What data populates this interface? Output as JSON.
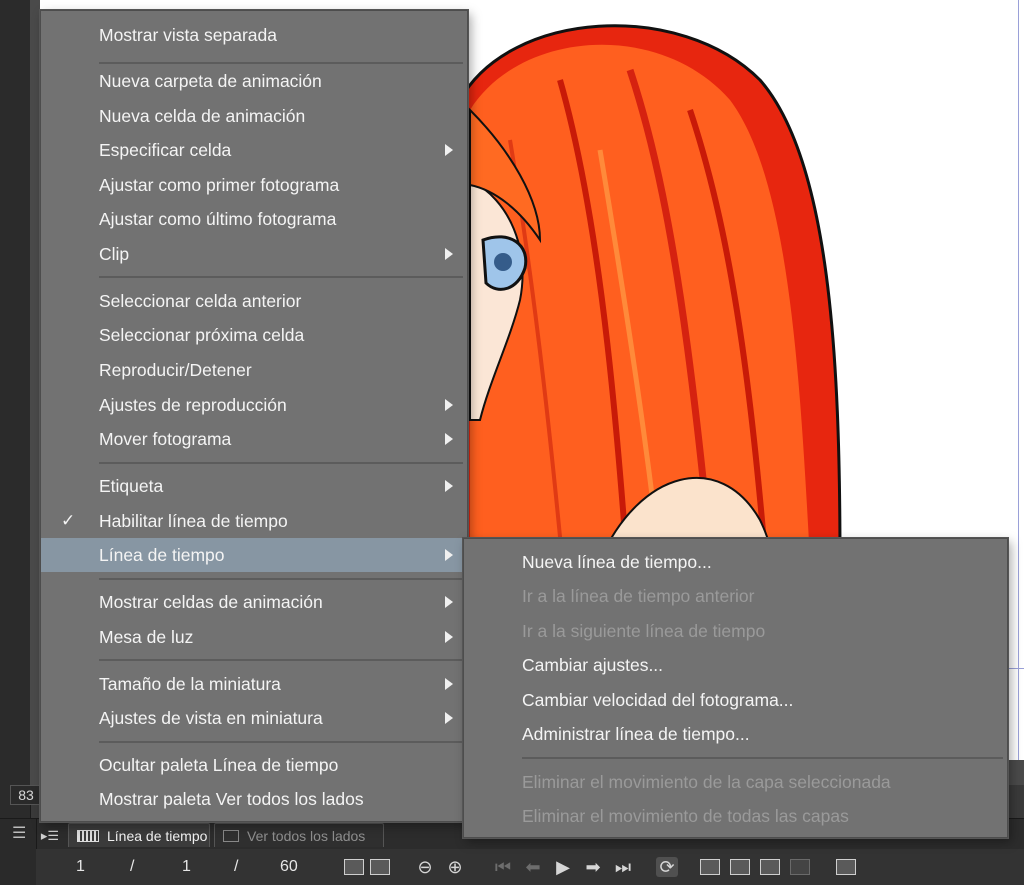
{
  "canvas": {
    "zoom_readout": "83"
  },
  "main_menu": {
    "items": [
      {
        "label": "Mostrar vista separada",
        "submenu": false
      },
      {
        "label": "Nueva carpeta de animación",
        "submenu": false
      },
      {
        "label": "Nueva celda de animación",
        "submenu": false
      },
      {
        "label": "Especificar celda",
        "submenu": true
      },
      {
        "label": "Ajustar como primer fotograma",
        "submenu": false
      },
      {
        "label": "Ajustar como último fotograma",
        "submenu": false
      },
      {
        "label": "Clip",
        "submenu": true
      },
      {
        "label": "Seleccionar celda anterior",
        "submenu": false
      },
      {
        "label": "Seleccionar próxima celda",
        "submenu": false
      },
      {
        "label": "Reproducir/Detener",
        "submenu": false
      },
      {
        "label": "Ajustes de reproducción",
        "submenu": true
      },
      {
        "label": "Mover fotograma",
        "submenu": true
      },
      {
        "label": "Etiqueta",
        "submenu": true
      },
      {
        "label": "Habilitar línea de tiempo",
        "submenu": false,
        "checked": true,
        "check_glyph": "✓"
      },
      {
        "label": "Línea de tiempo",
        "submenu": true,
        "active": true
      },
      {
        "label": "Mostrar celdas de animación",
        "submenu": true
      },
      {
        "label": "Mesa de luz",
        "submenu": true
      },
      {
        "label": "Tamaño de la miniatura",
        "submenu": true
      },
      {
        "label": "Ajustes de vista en miniatura",
        "submenu": true
      },
      {
        "label": "Ocultar paleta Línea de tiempo",
        "submenu": false
      },
      {
        "label": "Mostrar paleta Ver todos los lados",
        "submenu": false
      }
    ]
  },
  "sub_menu": {
    "items": [
      {
        "label": "Nueva línea de tiempo...",
        "enabled": true
      },
      {
        "label": "Ir a la línea de tiempo anterior",
        "enabled": false
      },
      {
        "label": "Ir a la siguiente línea de tiempo",
        "enabled": false
      },
      {
        "label": "Cambiar ajustes...",
        "enabled": true
      },
      {
        "label": "Cambiar velocidad del fotograma...",
        "enabled": true
      },
      {
        "label": "Administrar línea de tiempo...",
        "enabled": true
      },
      {
        "label": "Eliminar el movimiento de la capa seleccionada",
        "enabled": false
      },
      {
        "label": "Eliminar el movimiento de todas las capas",
        "enabled": false
      }
    ]
  },
  "timeline_panel": {
    "tabs": [
      {
        "label": "Línea de tiempo",
        "active": true,
        "icon": "timeline-icon"
      },
      {
        "label": "Ver todos los lados",
        "active": false,
        "icon": "camera-icon"
      }
    ],
    "frame_counter": {
      "current": "1",
      "sep1": "/",
      "cell": "1",
      "sep2": "/",
      "total": "60"
    },
    "icons": {
      "menu": "☰",
      "toggle": "▸☰",
      "zoom_out": "⊖",
      "zoom_in": "⊕",
      "first": "⏮",
      "prev": "⬅",
      "play": "▶",
      "next": "➡",
      "last": "⏭",
      "loop": "⟳"
    }
  },
  "colors": {
    "menu_bg": "#727272",
    "menu_active": "#8796a3",
    "menu_disabled_text": "#9a9a9a",
    "hair_orange": "#ff5a1a",
    "hair_red": "#e3200c"
  }
}
